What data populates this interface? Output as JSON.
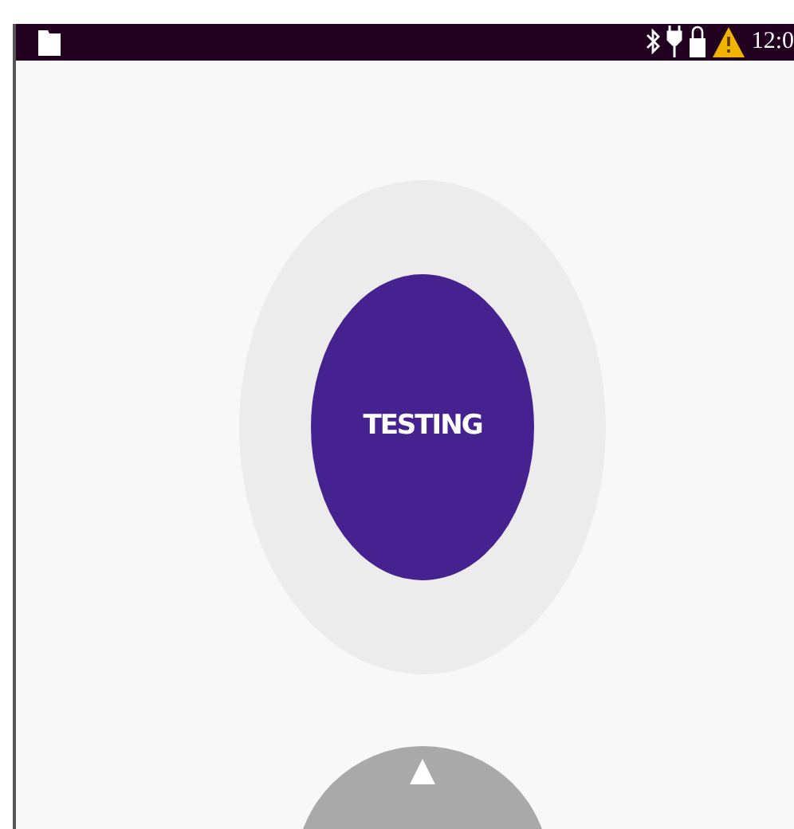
{
  "status_bar": {
    "time": "12:0"
  },
  "main_button": {
    "label": "TESTING"
  }
}
